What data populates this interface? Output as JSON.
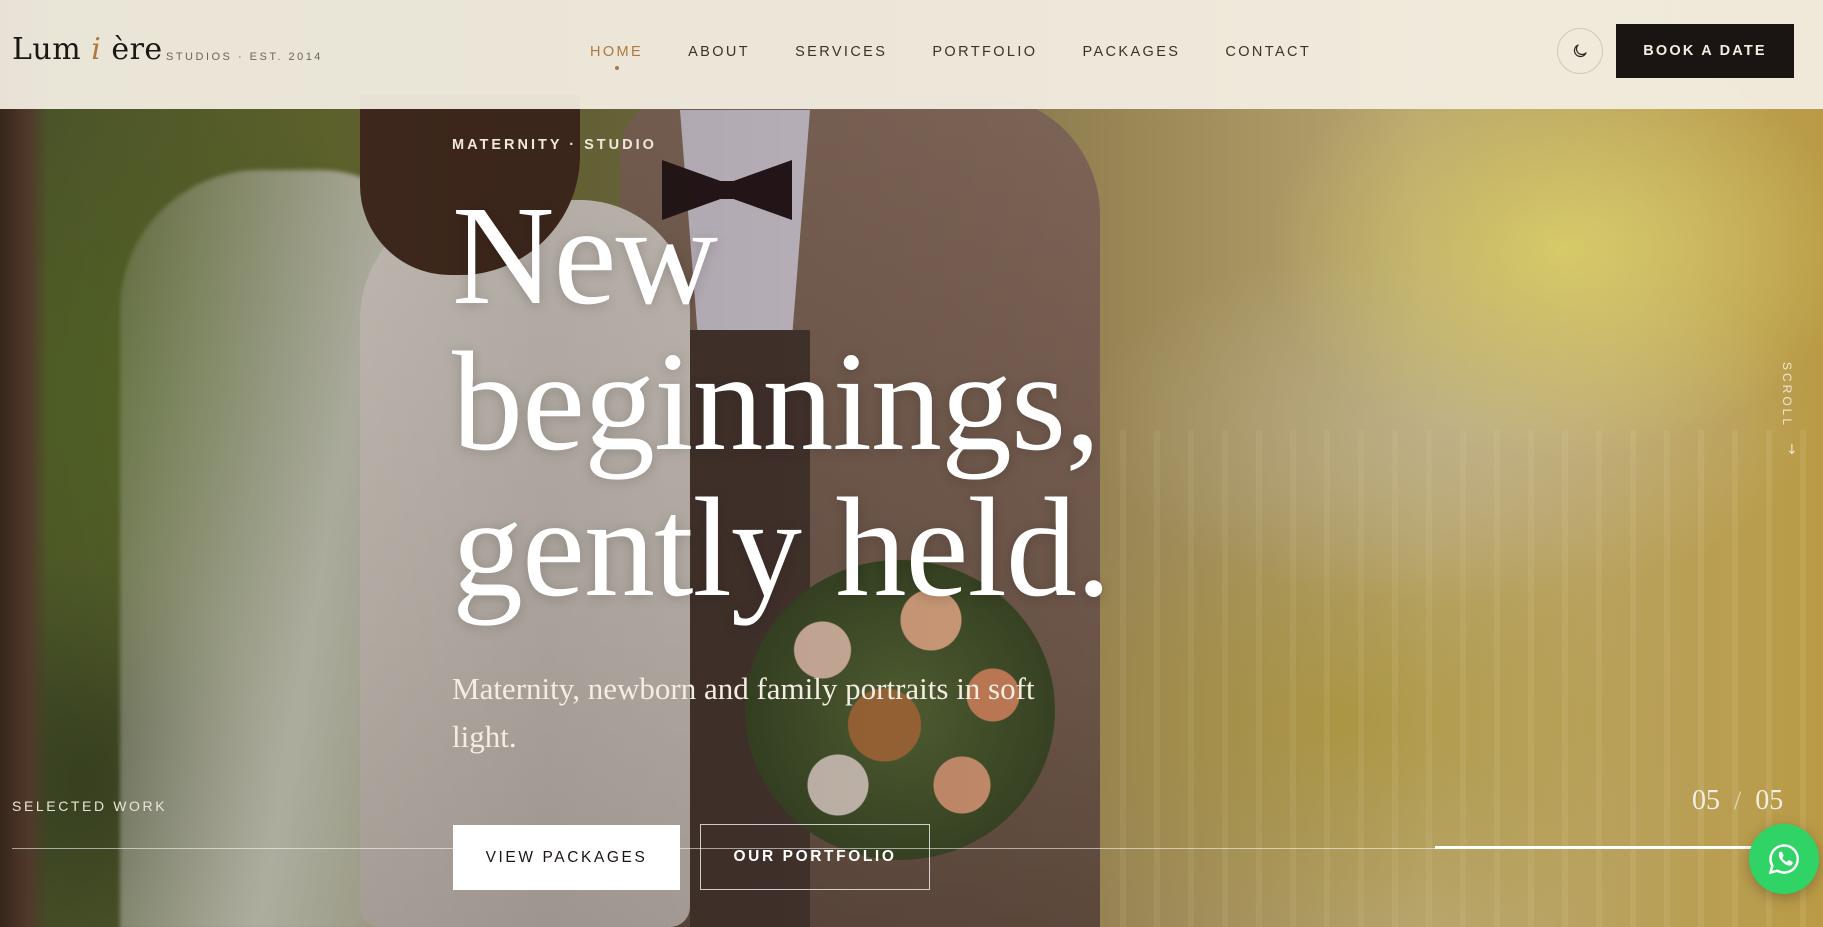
{
  "brand": {
    "logo_start": "Lum",
    "logo_mid": "i",
    "logo_end": "ère",
    "tagline": "STUDIOS · EST. 2014",
    "accent_color": "#b0783e"
  },
  "nav": {
    "items": [
      {
        "label": "HOME",
        "active": true
      },
      {
        "label": "ABOUT",
        "active": false
      },
      {
        "label": "SERVICES",
        "active": false
      },
      {
        "label": "PORTFOLIO",
        "active": false
      },
      {
        "label": "PACKAGES",
        "active": false
      },
      {
        "label": "CONTACT",
        "active": false
      }
    ],
    "theme_toggle_icon": "moon-icon",
    "cta_label": "BOOK A DATE"
  },
  "hero": {
    "eyebrow": "MATERNITY · STUDIO",
    "headline": [
      "New",
      "beginnings,",
      "gently held."
    ],
    "subtitle": "Maternity, newborn and family portraits in soft light.",
    "primary_button": "VIEW PACKAGES",
    "secondary_button": "OUR PORTFOLIO"
  },
  "slider": {
    "section_label": "SELECTED WORK",
    "current": "05",
    "separator": "/",
    "total": "05",
    "progress": 1.0
  },
  "scroll_hint": "SCROLL",
  "floating": {
    "whatsapp_icon": "whatsapp-icon",
    "whatsapp_color": "#2fd366"
  }
}
